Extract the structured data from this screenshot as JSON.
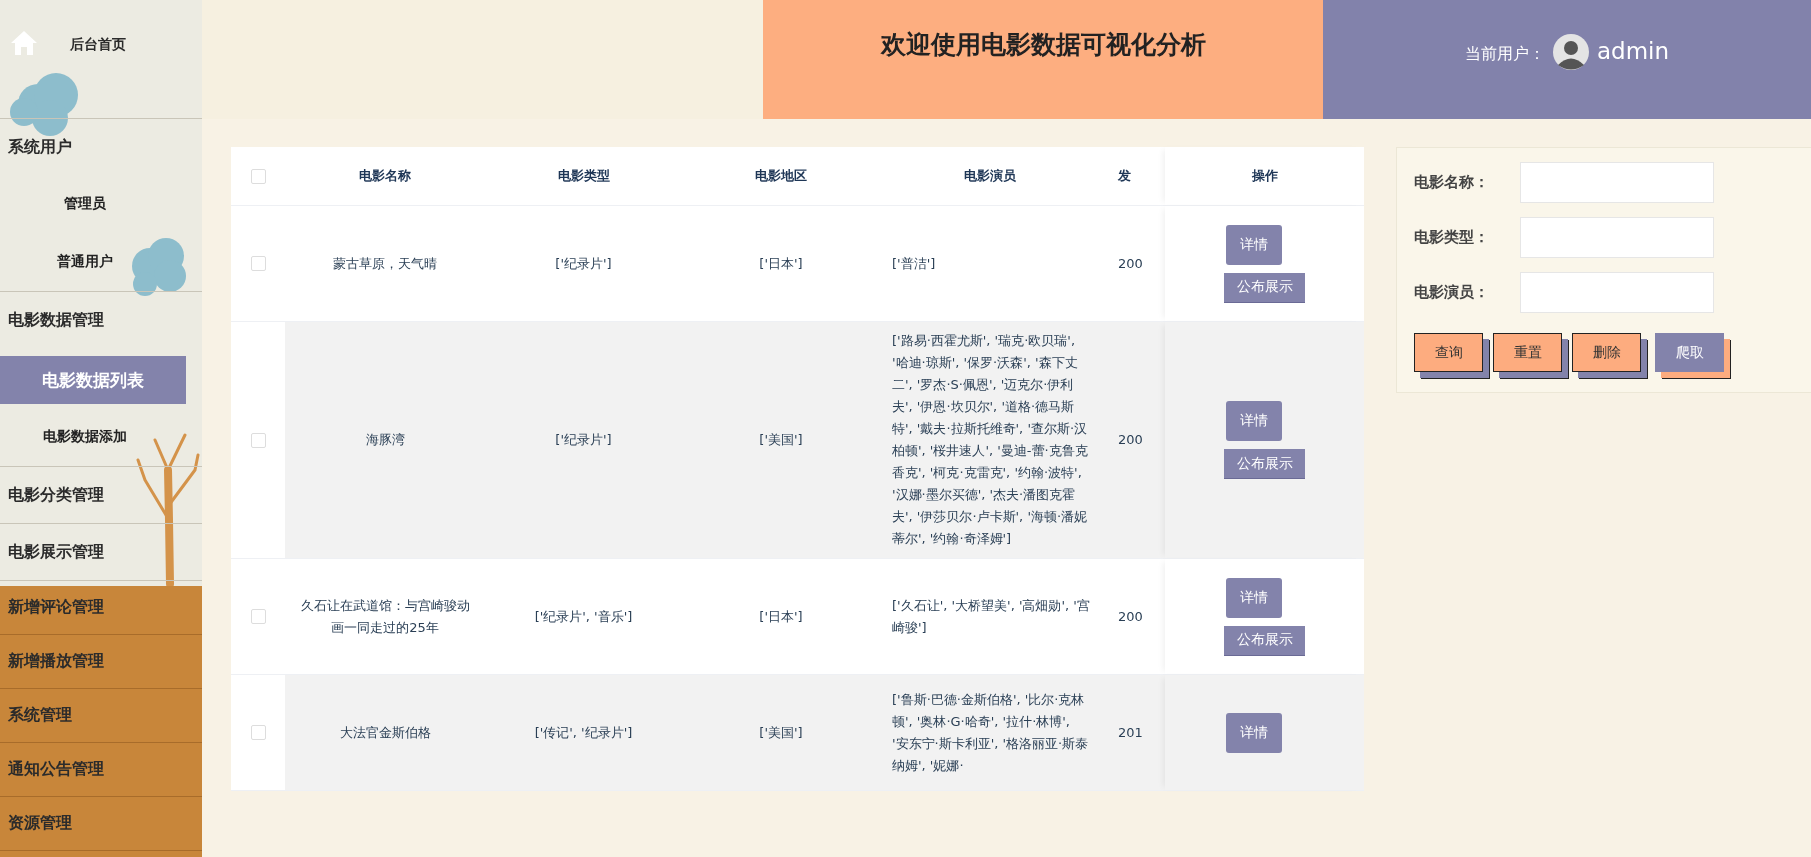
{
  "sidebar": {
    "items": [
      {
        "label": "后台首页",
        "selected": false
      },
      {
        "label": "系统用户",
        "selected": false,
        "expanded": true,
        "children": [
          {
            "label": "管理员",
            "selected": false
          },
          {
            "label": "普通用户",
            "selected": false
          }
        ]
      },
      {
        "label": "电影数据管理",
        "selected": false,
        "expanded": true,
        "children": [
          {
            "label": "电影数据列表",
            "selected": true
          },
          {
            "label": "电影数据添加",
            "selected": false
          }
        ]
      },
      {
        "label": "电影分类管理",
        "selected": false
      },
      {
        "label": "电影展示管理",
        "selected": false
      },
      {
        "label": "新增评论管理",
        "selected": false
      },
      {
        "label": "新增播放管理",
        "selected": false
      },
      {
        "label": "系统管理",
        "selected": false
      },
      {
        "label": "通知公告管理",
        "selected": false
      },
      {
        "label": "资源管理",
        "selected": false
      }
    ]
  },
  "header": {
    "title": "欢迎使用电影数据可视化分析",
    "user_label": "当前用户：",
    "username": "admin"
  },
  "table": {
    "select_all": {
      "checked": false
    },
    "columns": [
      "电影名称",
      "电影类型",
      "电影地区",
      "电影演员",
      "发",
      "操作"
    ],
    "rows": [
      {
        "checked": false,
        "cells": [
          "蒙古草原，天气晴",
          "['纪录片']",
          "['日本']",
          "['普洁']",
          "200"
        ],
        "actions": [
          "详情",
          "公布展示"
        ]
      },
      {
        "checked": false,
        "cells": [
          "海豚湾",
          "['纪录片']",
          "['美国']",
          "['路易·西霍尤斯', '瑞克·欧贝瑞', '哈迪·琼斯', '保罗·沃森', '森下丈二', '罗杰·S·佩恩', '迈克尔·伊利夫', '伊恩·坎贝尔', '道格·德马斯特', '戴夫·拉斯托维奇', '查尔斯·汉柏顿', '桜井速人', '曼迪-蕾·克鲁克香克', '柯克·克雷克', '约翰·波特', '汉娜·墨尔买德', '杰夫·潘图克霍夫', '伊莎贝尔·卢卡斯', '海顿·潘妮蒂尔', '约翰·奇泽姆']",
          "200"
        ],
        "actions": [
          "详情",
          "公布展示"
        ]
      },
      {
        "checked": false,
        "cells": [
          "久石让在武道馆：与宫崎骏动画一同走过的25年",
          "['纪录片', '音乐']",
          "['日本']",
          "['久石让', '大桥望美', '高畑勋', '宫崎骏']",
          "200"
        ],
        "actions": [
          "详情",
          "公布展示"
        ]
      },
      {
        "checked": false,
        "cells": [
          "大法官金斯伯格",
          "['传记', '纪录片']",
          "['美国']",
          "['鲁斯·巴德·金斯伯格', '比尔·克林顿', '奥林·G·哈奇', '拉什·林博', '安东宁·斯卡利亚', '格洛丽亚·斯泰纳姆', '妮娜·",
          "201"
        ],
        "actions": [
          "详情"
        ]
      }
    ]
  },
  "search": {
    "fields": [
      {
        "label": "电影名称："
      },
      {
        "label": "电影类型："
      },
      {
        "label": "电影演员："
      }
    ],
    "buttons": [
      {
        "label": "查询",
        "highlighted": false
      },
      {
        "label": "重置",
        "highlighted": false
      },
      {
        "label": "删除",
        "highlighted": false
      },
      {
        "label": "爬取",
        "highlighted": true
      }
    ]
  }
}
